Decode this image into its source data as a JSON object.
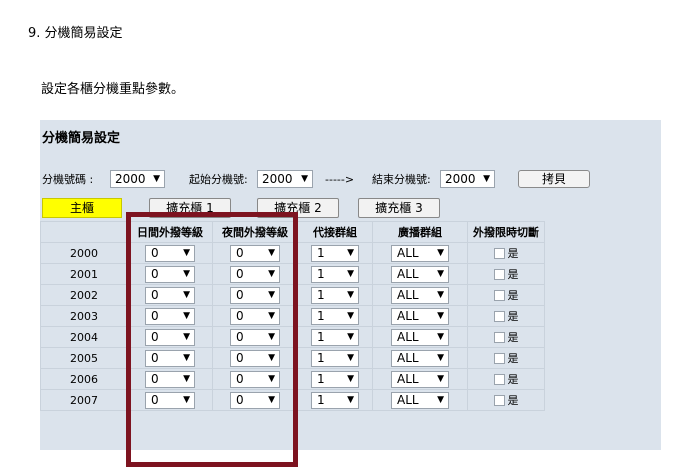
{
  "heading": "9. 分機簡易設定",
  "description": "設定各櫃分機重點參數。",
  "panel": {
    "title": "分機簡易設定",
    "range": {
      "start_label": "分機號碼 :",
      "start_value": "2000",
      "from_label": "起始分機號:",
      "from_value": "2000",
      "arrow_text": "----->",
      "end_label": "結束分機號:",
      "end_value": "2000",
      "copy_button": "拷貝"
    },
    "tabs": [
      "主櫃",
      "擴充櫃 1",
      "擴充櫃 2",
      "擴充櫃 3"
    ],
    "columns": [
      "",
      "日間外撥等級",
      "夜間外撥等級",
      "代接群組",
      "廣播群組",
      "外撥限時切斷"
    ],
    "rows": [
      {
        "ext": "2000",
        "day": "0",
        "night": "0",
        "pickup": "1",
        "broadcast": "ALL",
        "limit": "是"
      },
      {
        "ext": "2001",
        "day": "0",
        "night": "0",
        "pickup": "1",
        "broadcast": "ALL",
        "limit": "是"
      },
      {
        "ext": "2002",
        "day": "0",
        "night": "0",
        "pickup": "1",
        "broadcast": "ALL",
        "limit": "是"
      },
      {
        "ext": "2003",
        "day": "0",
        "night": "0",
        "pickup": "1",
        "broadcast": "ALL",
        "limit": "是"
      },
      {
        "ext": "2004",
        "day": "0",
        "night": "0",
        "pickup": "1",
        "broadcast": "ALL",
        "limit": "是"
      },
      {
        "ext": "2005",
        "day": "0",
        "night": "0",
        "pickup": "1",
        "broadcast": "ALL",
        "limit": "是"
      },
      {
        "ext": "2006",
        "day": "0",
        "night": "0",
        "pickup": "1",
        "broadcast": "ALL",
        "limit": "是"
      },
      {
        "ext": "2007",
        "day": "0",
        "night": "0",
        "pickup": "1",
        "broadcast": "ALL",
        "limit": "是"
      }
    ]
  },
  "colors": {
    "panel_bg": "#dbe3ec",
    "active_tab": "#ffff00",
    "highlight_border": "#7d1320"
  },
  "icons": {
    "dropdown": "triangle-down"
  }
}
